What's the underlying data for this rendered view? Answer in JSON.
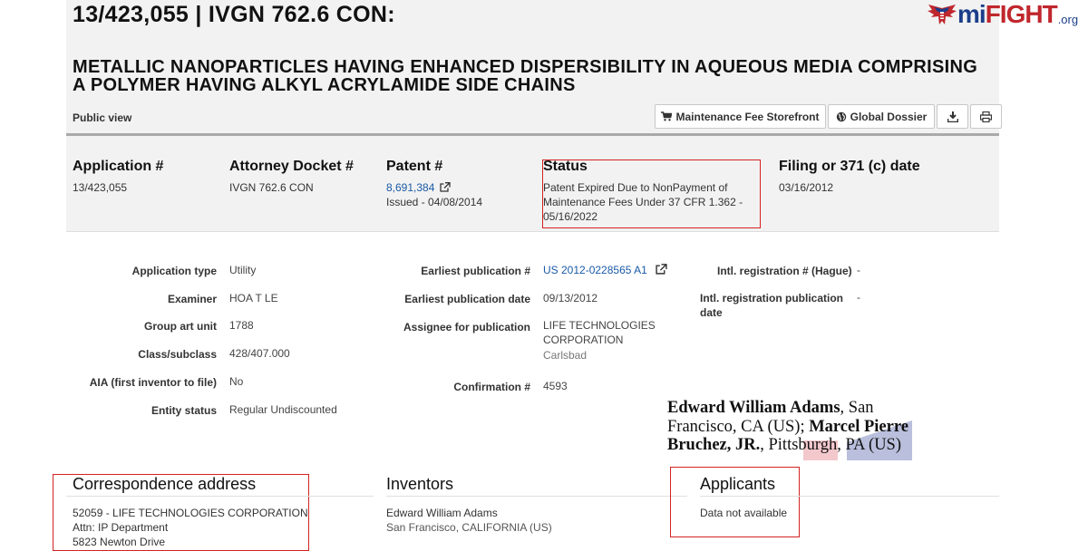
{
  "header": {
    "title": "13/423,055 | IVGN 762.6 CON:",
    "patent_title": "METALLIC NANOPARTICLES HAVING ENHANCED DISPERSIBILITY IN AQUEOUS MEDIA COMPRISING A POLYMER HAVING ALKYL ACRYLAMIDE SIDE CHAINS",
    "public_view": "Public view",
    "logo": {
      "brand_a": "mi",
      "brand_b": "FIGHT",
      "suffix": ".org"
    }
  },
  "toolbar": {
    "storefront_label": "Maintenance Fee Storefront",
    "dossier_label": "Global Dossier",
    "download_icon": "download-icon",
    "print_icon": "print-icon"
  },
  "summary": {
    "application": {
      "label": "Application #",
      "value": "13/423,055"
    },
    "attorney": {
      "label": "Attorney Docket #",
      "value": "IVGN 762.6 CON"
    },
    "patent": {
      "label": "Patent #",
      "number": "8,691,384",
      "issued": "Issued - 04/08/2014"
    },
    "status": {
      "label": "Status",
      "value": "Patent Expired Due to NonPayment of Maintenance Fees Under 37 CFR 1.362 - 05/16/2022"
    },
    "filing": {
      "label": "Filing or 371 (c) date",
      "value": "03/16/2012"
    }
  },
  "details_left": {
    "application_type": {
      "label": "Application type",
      "value": "Utility"
    },
    "examiner": {
      "label": "Examiner",
      "value": "HOA T LE"
    },
    "group_art_unit": {
      "label": "Group art unit",
      "value": "1788"
    },
    "class_subclass": {
      "label": "Class/subclass",
      "value": "428/407.000"
    },
    "aia": {
      "label": "AIA (first inventor to file)",
      "value": "No"
    },
    "entity_status": {
      "label": "Entity status",
      "value": "Regular Undiscounted"
    }
  },
  "details_mid": {
    "earliest_pub_num": {
      "label": "Earliest publication #",
      "value": "US 2012-0228565 A1"
    },
    "earliest_pub_date": {
      "label": "Earliest publication date",
      "value": "09/13/2012"
    },
    "assignee": {
      "label": "Assignee for publication",
      "line1": "LIFE TECHNOLOGIES",
      "line2": "CORPORATION",
      "city": "Carlsbad"
    },
    "confirmation": {
      "label": "Confirmation #",
      "value": "4593"
    }
  },
  "details_right": {
    "intl_reg": {
      "label": "Intl. registration # (Hague)",
      "value": "-"
    },
    "intl_reg_date": {
      "label": "Intl. registration publication date",
      "value": "-"
    }
  },
  "signature": {
    "n1": "Edward William Adams",
    "t1": ", San Francisco, CA (US); ",
    "n2": "Marcel Pierre Bruchez, JR.",
    "t2": ", Pittsburgh, PA (US)"
  },
  "sections": {
    "correspondence": {
      "title": "Correspondence address",
      "line1": "52059 - LIFE TECHNOLOGIES CORPORATION",
      "line2": "Attn: IP Department",
      "line3": "5823 Newton Drive"
    },
    "inventors": {
      "title": "Inventors",
      "name": "Edward William Adams",
      "location": "San Francisco, CALIFORNIA (US)"
    },
    "applicants": {
      "title": "Applicants",
      "value": "Data not available"
    }
  },
  "colors": {
    "highlight_box": "#d42222",
    "link": "#1a5aa6",
    "panel": "#f2f2f2"
  }
}
